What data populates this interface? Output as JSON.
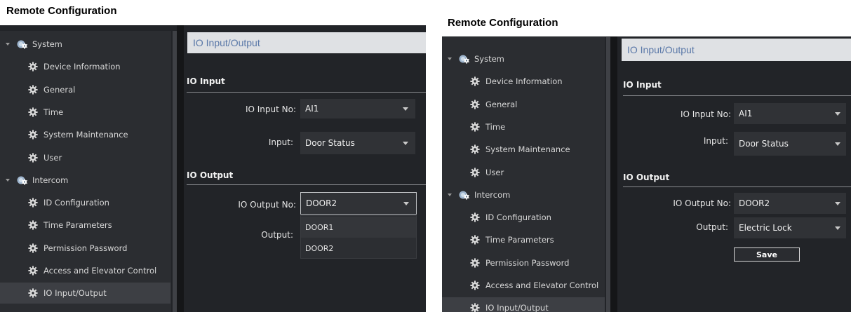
{
  "left": {
    "window_title": "Remote Configuration",
    "tree": [
      {
        "label": "System",
        "type": "group"
      },
      {
        "label": "Device Information",
        "type": "leaf"
      },
      {
        "label": "General",
        "type": "leaf"
      },
      {
        "label": "Time",
        "type": "leaf"
      },
      {
        "label": "System Maintenance",
        "type": "leaf"
      },
      {
        "label": "User",
        "type": "leaf"
      },
      {
        "label": "Intercom",
        "type": "group"
      },
      {
        "label": "ID Configuration",
        "type": "leaf"
      },
      {
        "label": "Time Parameters",
        "type": "leaf"
      },
      {
        "label": "Permission Password",
        "type": "leaf"
      },
      {
        "label": "Access and Elevator Control",
        "type": "leaf"
      },
      {
        "label": "IO Input/Output",
        "type": "leaf",
        "selected": true
      }
    ],
    "header": "IO Input/Output",
    "io_input_title": "IO Input",
    "io_input_no_label": "IO Input No:",
    "io_input_no_value": "AI1",
    "input_label": "Input:",
    "input_value": "Door Status",
    "io_output_title": "IO Output",
    "io_output_no_label": "IO Output No:",
    "io_output_no_value": "DOOR2",
    "output_label": "Output:",
    "dropdown_options": [
      "DOOR1",
      "DOOR2"
    ]
  },
  "right": {
    "window_title": "Remote Configuration",
    "tree": [
      {
        "label": "System",
        "type": "group"
      },
      {
        "label": "Device Information",
        "type": "leaf"
      },
      {
        "label": "General",
        "type": "leaf"
      },
      {
        "label": "Time",
        "type": "leaf"
      },
      {
        "label": "System Maintenance",
        "type": "leaf"
      },
      {
        "label": "User",
        "type": "leaf"
      },
      {
        "label": "Intercom",
        "type": "group"
      },
      {
        "label": "ID Configuration",
        "type": "leaf"
      },
      {
        "label": "Time Parameters",
        "type": "leaf"
      },
      {
        "label": "Permission Password",
        "type": "leaf"
      },
      {
        "label": "Access and Elevator Control",
        "type": "leaf"
      },
      {
        "label": "IO Input/Output",
        "type": "leaf",
        "selected": true
      }
    ],
    "header": "IO Input/Output",
    "io_input_title": "IO Input",
    "io_input_no_label": "IO Input No:",
    "io_input_no_value": "AI1",
    "input_label": "Input:",
    "input_value": "Door Status",
    "io_output_title": "IO Output",
    "io_output_no_label": "IO Output No:",
    "io_output_no_value": "DOOR2",
    "output_label": "Output:",
    "output_value": "Electric Lock",
    "save_label": "Save"
  },
  "icons": {
    "gear": "gear-icon",
    "group": "globe-gear-icon",
    "caret": "caret-down-icon",
    "dropdown": "chevron-down-icon"
  },
  "colors": {
    "panel_bg": "#222428",
    "header_text": "#5a78a8",
    "header_bg": "#dfe1e4"
  }
}
